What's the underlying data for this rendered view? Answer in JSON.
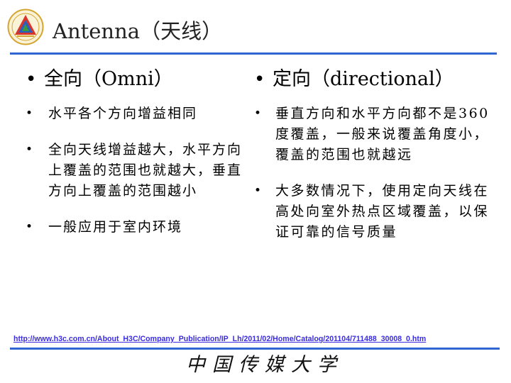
{
  "header": {
    "title": "Antenna（天线）"
  },
  "left": {
    "heading": "全向（Omni）",
    "items": [
      "水平各个方向增益相同",
      "全向天线增益越大，水平方向上覆盖的范围也就越大，垂直方向上覆盖的范围越小",
      "一般应用于室内环境"
    ]
  },
  "right": {
    "heading": "定向（directional）",
    "items": [
      "垂直方向和水平方向都不是360度覆盖，一般来说覆盖角度小，覆盖的范围也就越远",
      "大多数情况下，使用定向天线在高处向室外热点区域覆盖，以保证可靠的信号质量"
    ]
  },
  "footer": {
    "link": "http://www.h3c.com.cn/About_H3C/Company_Publication/IP_Lh/2011/02/Home/Catalog/201104/711488_30008_0.htm",
    "school": "中国传媒大学"
  },
  "colors": {
    "accent": "#2f66d1",
    "link": "#3a2ce0"
  }
}
